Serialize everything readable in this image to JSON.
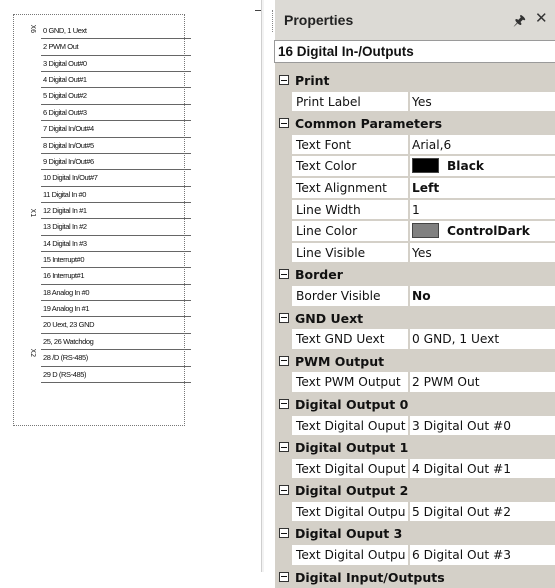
{
  "strip": {
    "connectors": [
      "X6",
      "X1",
      "X2"
    ],
    "rows": [
      "0 GND, 1 Uext",
      "2 PWM Out",
      "3 Digital Out#0",
      "4 Digital Out#1",
      "5 Digital Out#2",
      "6 Digital Out#3",
      "7 Digital In/Out#4",
      "8 Digital In/Out#5",
      "9 Digital In/Out#6",
      "10 Digital In/Out#7",
      "11 Digital In #0",
      "12 Digital In #1",
      "13 Digital In #2",
      "14 Digital In #3",
      "15 Interrupt#0",
      "16 Interrupt#1",
      "18 Analog In #0",
      "19 Analog In #1",
      "20 Uext, 23 GND",
      "25, 26 Watchdog",
      "28 /D (RS-485)",
      "29 D (RS-485)"
    ]
  },
  "panel": {
    "title": "Properties",
    "pin_icon": "pin-icon",
    "close_icon": "close-icon",
    "object": "16 Digital In-/Outputs"
  },
  "colors": {
    "black": "#000000",
    "controldark": "#808080"
  },
  "grid": [
    {
      "kind": "cat",
      "label": "Print"
    },
    {
      "kind": "prop",
      "name": "Print Label",
      "value": "Yes"
    },
    {
      "kind": "cat",
      "label": "Common Parameters"
    },
    {
      "kind": "prop",
      "name": "Text Font",
      "value": "Arial,6"
    },
    {
      "kind": "prop",
      "name": "Text Color",
      "value": "Black",
      "swatch": "#000000",
      "bold": true
    },
    {
      "kind": "prop",
      "name": "Text Alignment",
      "value": "Left",
      "bold": true
    },
    {
      "kind": "prop",
      "name": "Line Width",
      "value": "1"
    },
    {
      "kind": "prop",
      "name": "Line Color",
      "value": "ControlDark",
      "swatch": "#808080",
      "bold": true
    },
    {
      "kind": "prop",
      "name": "Line Visible",
      "value": "Yes"
    },
    {
      "kind": "cat",
      "label": "Border"
    },
    {
      "kind": "prop",
      "name": "Border Visible",
      "value": "No",
      "bold": true
    },
    {
      "kind": "cat",
      "label": "GND Uext"
    },
    {
      "kind": "prop",
      "name": "Text GND Uext",
      "value": "0 GND, 1 Uext"
    },
    {
      "kind": "cat",
      "label": "PWM Output"
    },
    {
      "kind": "prop",
      "name": "Text PWM Output",
      "value": "2 PWM Out"
    },
    {
      "kind": "cat",
      "label": "Digital Output 0"
    },
    {
      "kind": "prop",
      "name": "Text Digital Ouput",
      "value": "3 Digital Out #0"
    },
    {
      "kind": "cat",
      "label": "Digital Output 1"
    },
    {
      "kind": "prop",
      "name": "Text Digital Ouput",
      "value": "4 Digital Out #1"
    },
    {
      "kind": "cat",
      "label": "Digital Output 2"
    },
    {
      "kind": "prop",
      "name": "Text Digital Outpu",
      "value": "5 Digital Out #2"
    },
    {
      "kind": "cat",
      "label": "Digital Ouput 3"
    },
    {
      "kind": "prop",
      "name": "Text Digital Outpu",
      "value": "6 Digital Out #3"
    },
    {
      "kind": "cat",
      "label": "Digital Input/Outputs"
    }
  ]
}
